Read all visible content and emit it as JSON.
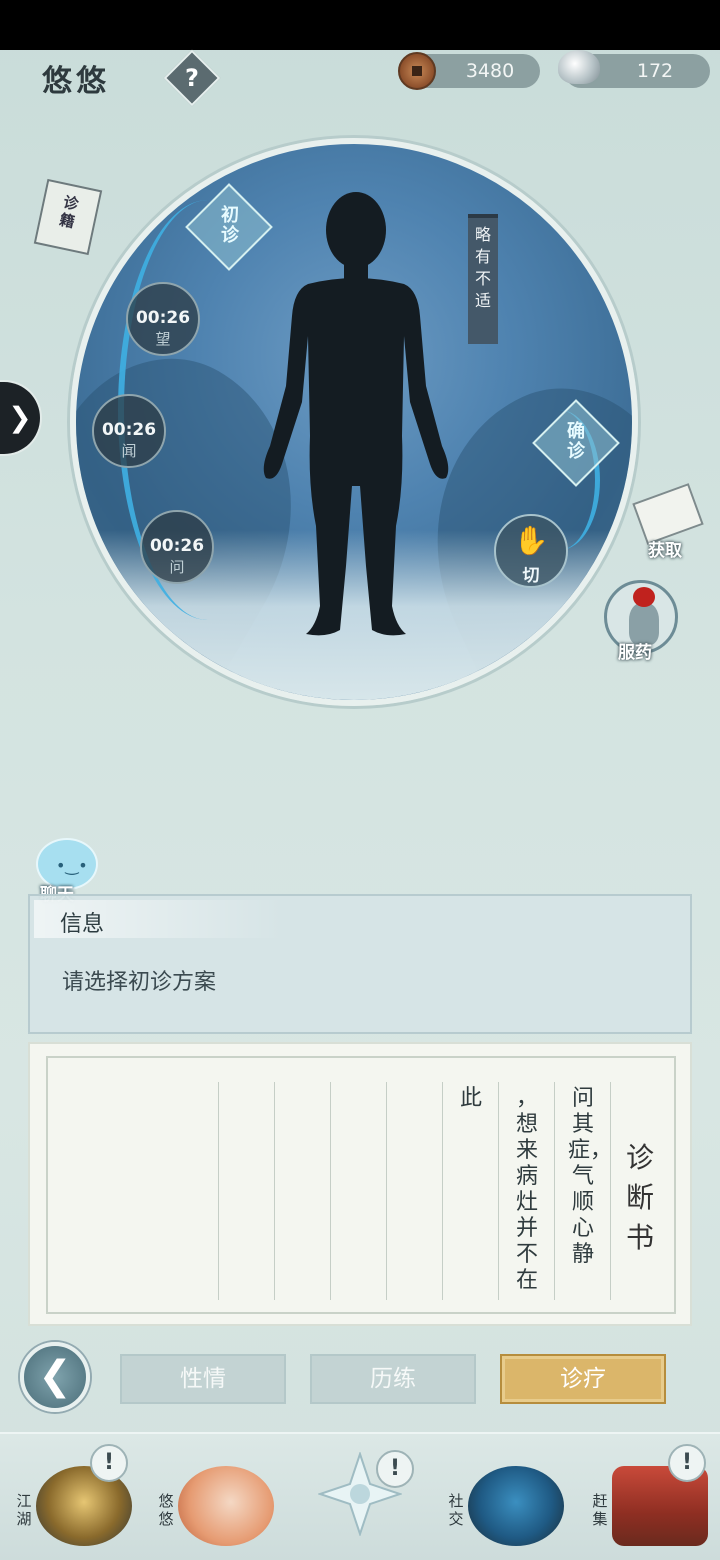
{
  "header": {
    "player_name": "悠悠",
    "help": "?",
    "copper": "3480",
    "silver": "172"
  },
  "diagnosis": {
    "first_diag": "初诊",
    "confirm_diag": "确诊",
    "status_banner": "略有不适",
    "timers": [
      {
        "time": "00:26",
        "sense": "望"
      },
      {
        "time": "00:26",
        "sense": "闻"
      },
      {
        "time": "00:26",
        "sense": "问"
      }
    ],
    "pulse_label": "切"
  },
  "side": {
    "book_label": "诊籍",
    "acquire_label": "获取",
    "medicine_label": "服药",
    "chat_label": "聊天"
  },
  "info": {
    "title": "信息",
    "text": "请选择初诊方案"
  },
  "paper": {
    "title": "诊断书",
    "columns": [
      "问其症，气顺心静",
      "，想来病灶并不在",
      "此",
      "",
      "",
      "",
      "",
      ""
    ]
  },
  "tabs": [
    {
      "label": "性情",
      "active": false
    },
    {
      "label": "历练",
      "active": false
    },
    {
      "label": "诊疗",
      "active": true
    }
  ],
  "nav": [
    {
      "label": "江湖",
      "alert": "!"
    },
    {
      "label": "悠悠",
      "alert": ""
    },
    {
      "label": "",
      "alert": "!"
    },
    {
      "label": "社交",
      "alert": ""
    },
    {
      "label": "赶集",
      "alert": "!"
    }
  ],
  "colors": {
    "accent_gold": "#dbb66a",
    "accent_blue": "#3fb0e3",
    "circle_bg": "#4f83b0"
  },
  "icons": [
    "help-icon",
    "copper-coin-icon",
    "silver-ingot-icon",
    "expand-arrow-icon",
    "book-icon",
    "scroll-icon",
    "medicine-bottle-icon",
    "chat-bubble-icon",
    "back-arrow-icon",
    "pulse-hand-icon"
  ]
}
